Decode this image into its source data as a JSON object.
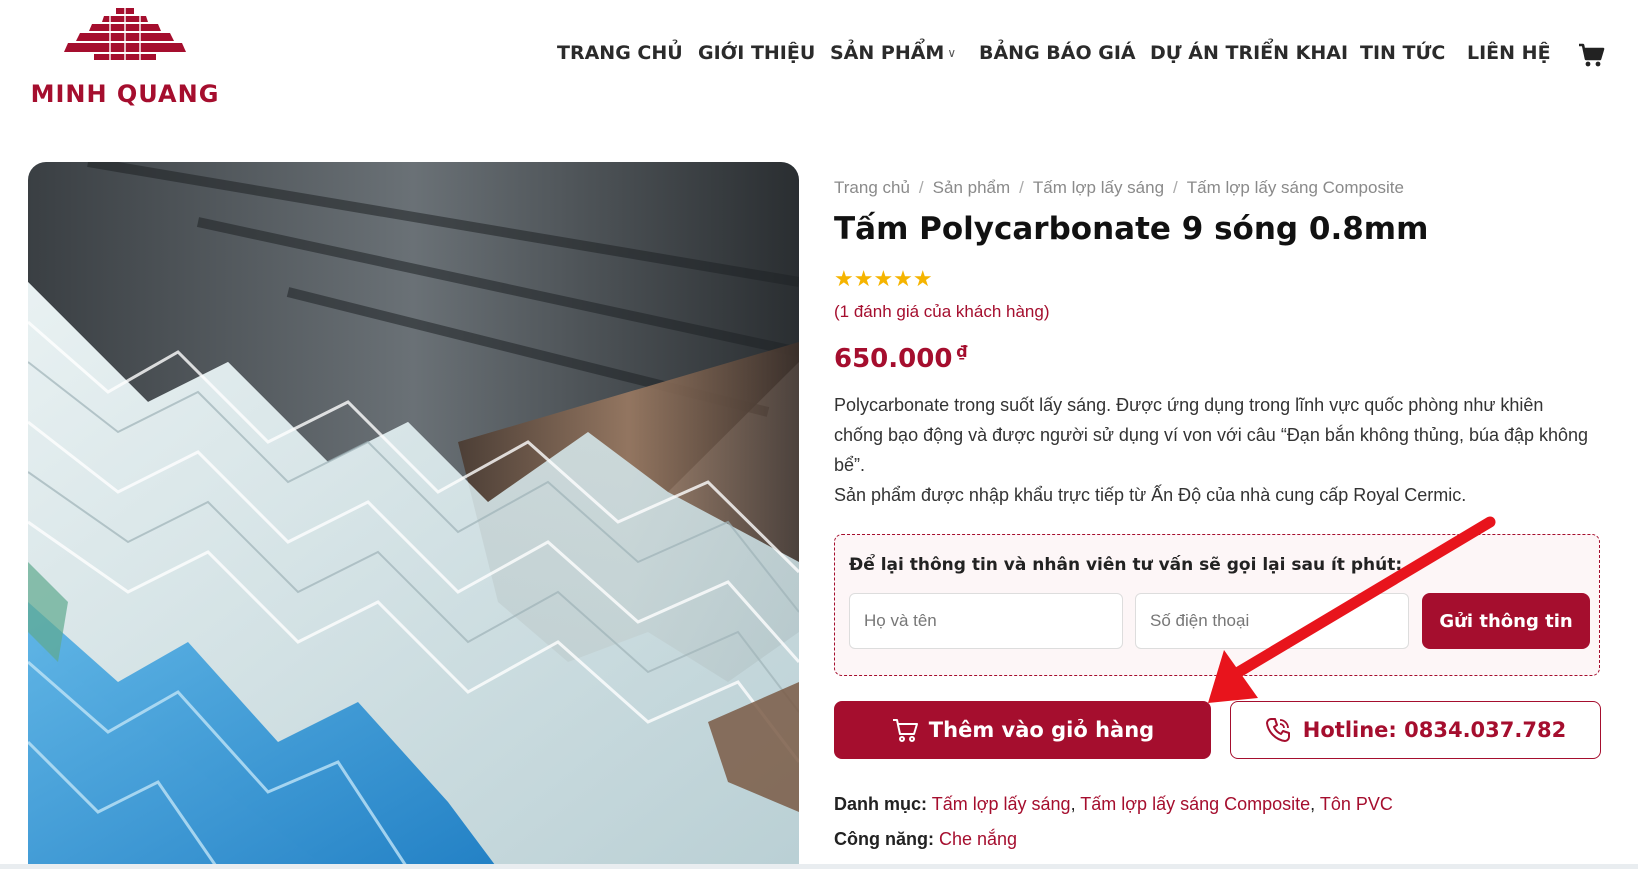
{
  "brand": {
    "name": "MINH QUANG",
    "color": "#a50e2e"
  },
  "nav": {
    "items": [
      {
        "label": "TRANG CHỦ"
      },
      {
        "label": "GIỚI THIỆU"
      },
      {
        "label": "SẢN PHẨM",
        "has_dropdown": true
      },
      {
        "label": "BẢNG BÁO GIÁ"
      },
      {
        "label": "DỰ ÁN TRIỂN KHAI"
      },
      {
        "label": "TIN TỨC"
      },
      {
        "label": "LIÊN HỆ"
      }
    ],
    "cart_icon": "cart-icon"
  },
  "breadcrumb": [
    "Trang chủ",
    "Sản phẩm",
    "Tấm lợp lấy sáng",
    "Tấm lợp lấy sáng Composite"
  ],
  "product": {
    "title": "Tấm Polycarbonate 9 sóng 0.8mm",
    "rating": 5,
    "rating_max": 5,
    "stars": "★★★★★",
    "reviews": "(1 đánh giá của khách hàng)",
    "price": "650.000",
    "currency": "₫",
    "description": [
      "Polycarbonate trong suốt lấy sáng. Được ứng dụng trong lĩnh vực quốc phòng như khiên chống bạo động và được người sử dụng ví von với câu “Đạn bắn không thủng, búa đập không bể”.",
      "Sản phẩm được nhập khẩu trực tiếp từ Ấn Độ của nhà cung cấp Royal Cermic."
    ]
  },
  "lead_form": {
    "title": "Để lại thông tin và nhân viên tư vấn sẽ gọi lại sau ít phút:",
    "name_placeholder": "Họ và tên",
    "phone_placeholder": "Số điện thoại",
    "submit_label": "Gửi thông tin"
  },
  "actions": {
    "add_to_cart": "Thêm vào giỏ hàng",
    "hotline": "Hotline: 0834.037.782"
  },
  "meta": {
    "category_label": "Danh mục:",
    "categories": [
      "Tấm lợp lấy sáng",
      "Tấm lợp lấy sáng Composite",
      "Tôn PVC"
    ],
    "function_label": "Công năng:",
    "function": "Che nắng"
  },
  "colors": {
    "accent": "#a50e2e",
    "star": "#f5b400",
    "annotation_arrow": "#e8141c"
  }
}
